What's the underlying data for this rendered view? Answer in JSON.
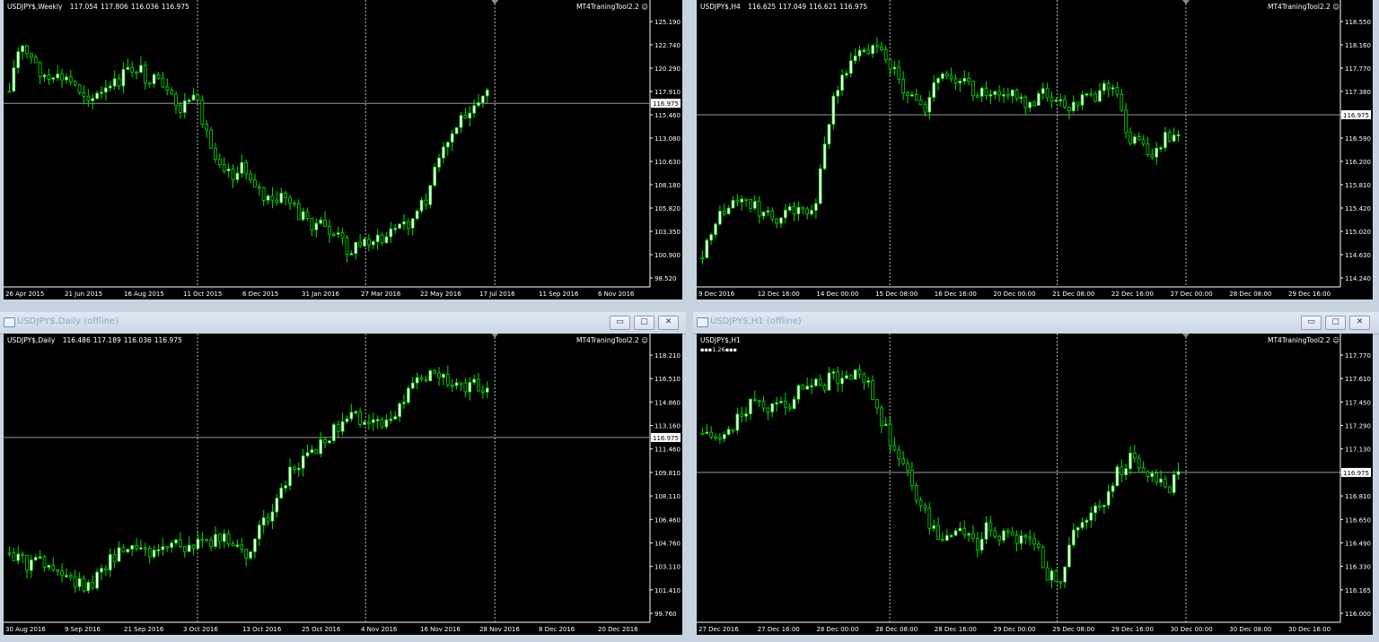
{
  "colors": {
    "background": "#000000",
    "candle": "#00e000",
    "frame": "#c8d3e0",
    "axis_text": "#ffffff"
  },
  "charts": [
    {
      "window_title": "",
      "header": {
        "symbol": "USDJPY$,Weekly",
        "open": "117.054",
        "high": "117.806",
        "low": "116.036",
        "close": "116.975"
      },
      "tool": "MT4TraningTool2.2",
      "current_price": "116.975",
      "price_ticks": [
        "125.190",
        "122.740",
        "120.290",
        "117.910",
        "115.460",
        "113.080",
        "110.630",
        "108.180",
        "105.820",
        "103.350",
        "100.900",
        "98.520"
      ],
      "time_ticks": [
        "26 Apr 2015",
        "21 Jun 2015",
        "16 Aug 2015",
        "11 Oct 2015",
        "6 Dec 2015",
        "31 Jan 2016",
        "27 Mar 2016",
        "22 May 2016",
        "17 Jul 2016",
        "11 Sep 2016",
        "6 Nov 2016"
      ],
      "icons": [
        "smiley-icon",
        "scroll-marker-icon"
      ]
    },
    {
      "window_title": "",
      "header": {
        "symbol": "USDJPY$,H4",
        "open": "116.625",
        "high": "117.049",
        "low": "116.621",
        "close": "116.975"
      },
      "tool": "MT4TraningTool2.2",
      "current_price": "116.975",
      "price_ticks": [
        "118.550",
        "118.160",
        "117.770",
        "117.380",
        "116.975",
        "116.590",
        "116.200",
        "115.810",
        "115.420",
        "115.020",
        "114.630",
        "114.240"
      ],
      "time_ticks": [
        "9 Dec 2016",
        "12 Dec 16:00",
        "14 Dec 00:00",
        "15 Dec 08:00",
        "16 Dec 16:00",
        "20 Dec 00:00",
        "21 Dec 08:00",
        "22 Dec 16:00",
        "27 Dec 00:00",
        "28 Dec 08:00",
        "29 Dec 16:00"
      ],
      "icons": [
        "smiley-icon",
        "scroll-marker-icon"
      ]
    },
    {
      "window_title": "USDJPY$,Daily (offline)",
      "header": {
        "symbol": "USDJPY$,Daily",
        "open": "116.486",
        "high": "117.189",
        "low": "116.036",
        "close": "116.975"
      },
      "tool": "MT4TraningTool2.2",
      "current_price": "116.975",
      "price_ticks": [
        "118.210",
        "116.510",
        "114.860",
        "113.160",
        "111.460",
        "109.810",
        "108.110",
        "106.460",
        "104.760",
        "103.110",
        "101.410",
        "99.760"
      ],
      "time_ticks": [
        "30 Aug 2016",
        "9 Sep 2016",
        "21 Sep 2016",
        "3 Oct 2016",
        "13 Oct 2016",
        "25 Oct 2016",
        "4 Nov 2016",
        "16 Nov 2016",
        "28 Nov 2016",
        "8 Dec 2016",
        "20 Dec 2016"
      ],
      "icons": [
        "chart-window-icon",
        "minimize-icon",
        "maximize-icon",
        "close-icon",
        "smiley-icon",
        "scroll-marker-icon"
      ]
    },
    {
      "window_title": "USDJPY$,H1 (offline)",
      "header": {
        "symbol": "USDJPY$,H1",
        "open": "",
        "high": "",
        "low": "",
        "close": ""
      },
      "badge": "1.26",
      "tool": "MT4TraningTool2.2",
      "current_price": "116.975",
      "price_ticks": [
        "117.770",
        "117.610",
        "117.450",
        "117.290",
        "117.130",
        "116.975",
        "116.810",
        "116.650",
        "116.490",
        "116.330",
        "116.165",
        "116.000"
      ],
      "time_ticks": [
        "27 Dec 2016",
        "27 Dec 16:00",
        "28 Dec 00:00",
        "28 Dec 08:00",
        "28 Dec 16:00",
        "29 Dec 00:00",
        "29 Dec 08:00",
        "29 Dec 16:00",
        "30 Dec 00:00",
        "30 Dec 08:00",
        "30 Dec 16:00"
      ],
      "icons": [
        "chart-window-icon",
        "minimize-icon",
        "maximize-icon",
        "close-icon",
        "smiley-icon",
        "scroll-marker-icon"
      ]
    }
  ],
  "window_buttons": {
    "minimize": "▭",
    "maximize": "▢",
    "close": "✕"
  }
}
